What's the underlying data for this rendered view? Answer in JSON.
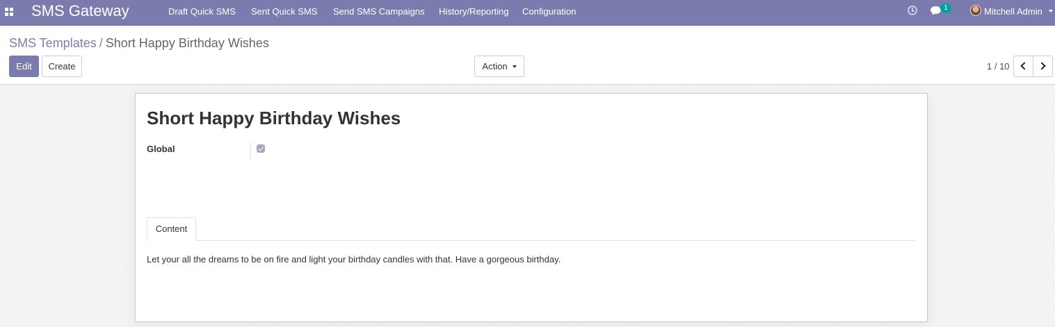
{
  "navbar": {
    "app_title": "SMS Gateway",
    "menu": [
      "Draft Quick SMS",
      "Sent Quick SMS",
      "Send SMS Campaigns",
      "History/Reporting",
      "Configuration"
    ],
    "messages_count": "1",
    "user_name": "Mitchell Admin",
    "icons": [
      "apps-grid-icon",
      "clock-icon",
      "chat-icon",
      "avatar"
    ]
  },
  "breadcrumb": {
    "parent": "SMS Templates",
    "separator": "/",
    "current": "Short Happy Birthday Wishes"
  },
  "toolbar": {
    "edit_label": "Edit",
    "create_label": "Create",
    "action_label": "Action"
  },
  "pager": {
    "value": "1 / 10"
  },
  "form": {
    "title": "Short Happy Birthday Wishes",
    "global_label": "Global",
    "global_checked": true,
    "tab_label": "Content",
    "content": "Let your all the dreams to be on fire and light your birthday candles with that. Have a gorgeous birthday."
  },
  "colors": {
    "brand": "#7c7bad",
    "badge": "#00a09d"
  }
}
